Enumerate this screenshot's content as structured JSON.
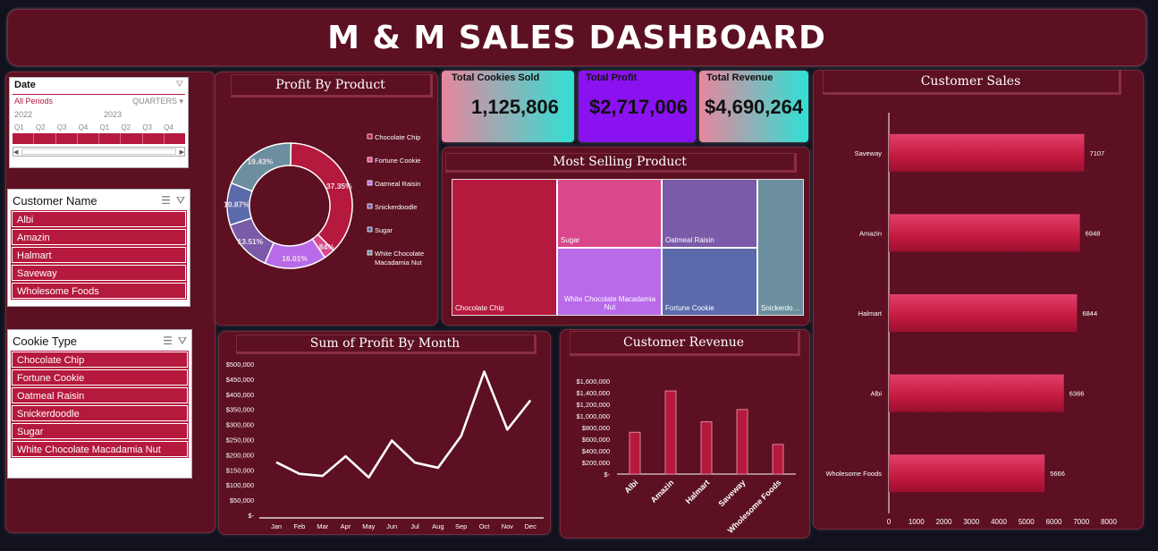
{
  "header": {
    "title": "M & M SALES DASHBOARD"
  },
  "date_slicer": {
    "label": "Date",
    "all_periods": "All Periods",
    "granularity": "QUARTERS",
    "years": [
      "2022",
      "2023"
    ],
    "quarters": [
      "Q1",
      "Q2",
      "Q3",
      "Q4",
      "Q1",
      "Q2",
      "Q3",
      "Q4"
    ]
  },
  "customer_slicer": {
    "label": "Customer Name",
    "items": [
      "Albi",
      "Amazin",
      "Halmart",
      "Saveway",
      "Wholesome Foods"
    ]
  },
  "cookie_slicer": {
    "label": "Cookie Type",
    "items": [
      "Chocolate Chip",
      "Fortune Cookie",
      "Oatmeal Raisin",
      "Snickerdoodle",
      "Sugar",
      "White Chocolate Macadamia Nut"
    ]
  },
  "kpis": {
    "cookies_label": "Total Cookies Sold",
    "cookies_value": "1,125,806",
    "profit_label": "Total Profit",
    "profit_value": "$2,717,006",
    "revenue_label": "Total Revenue",
    "revenue_value": "$4,690,264"
  },
  "titles": {
    "profit_by_product": "Profit By Product",
    "most_selling": "Most Selling Product",
    "customer_sales": "Customer Sales",
    "profit_by_month": "Sum of Profit By Month",
    "customer_revenue": "Customer Revenue"
  },
  "colors": {
    "panel": "#5c1022",
    "crimson": "#b5193e",
    "pink": "#d9488a",
    "violet": "#b86ae8",
    "purple": "#7b5aa8",
    "slate_blue": "#5a6aaa",
    "teal_gray": "#6b8f9e"
  },
  "chart_data": [
    {
      "id": "profit_by_product",
      "type": "pie",
      "title": "Profit By Product",
      "categories": [
        "Chocolate Chip",
        "Fortune Cookie",
        "Oatmeal Raisin",
        "Snickerdoodle",
        "Sugar",
        "White Chocolate Macadamia Nut"
      ],
      "values": [
        37.35,
        2.84,
        16.01,
        13.51,
        10.87,
        19.43
      ],
      "labels": [
        "37.35%",
        "2.84%",
        "16.01%",
        "13.51%",
        "10.87%",
        "19.43%"
      ],
      "legend": "right"
    },
    {
      "id": "most_selling_product",
      "type": "heatmap",
      "title": "Most Selling Product",
      "categories": [
        "Chocolate Chip",
        "Sugar",
        "White Chocolate Macadamia Nut",
        "Oatmeal Raisin",
        "Fortune Cookie",
        "Snickerdo…"
      ]
    },
    {
      "id": "customer_sales",
      "type": "bar",
      "title": "Customer Sales",
      "orientation": "horizontal",
      "categories": [
        "Saveway",
        "Amazin",
        "Halmart",
        "Albi",
        "Wholesome Foods"
      ],
      "values": [
        7107,
        6948,
        6844,
        6366,
        5666
      ],
      "xlim": [
        0,
        8000
      ],
      "ticks": [
        "0",
        "1000",
        "2000",
        "3000",
        "4000",
        "5000",
        "6000",
        "7000",
        "8000"
      ]
    },
    {
      "id": "profit_by_month",
      "type": "line",
      "title": "Sum of Profit By Month",
      "categories": [
        "Jan",
        "Feb",
        "Mar",
        "Apr",
        "May",
        "Jun",
        "Jul",
        "Aug",
        "Sep",
        "Oct",
        "Nov",
        "Dec"
      ],
      "values": [
        175000,
        137000,
        130000,
        195000,
        125000,
        247000,
        174000,
        157000,
        262000,
        475000,
        283000,
        380000
      ],
      "ylim": [
        0,
        500000
      ],
      "yticks": [
        "$-",
        "$50,000",
        "$100,000",
        "$150,000",
        "$200,000",
        "$250,000",
        "$300,000",
        "$350,000",
        "$400,000",
        "$450,000",
        "$500,000"
      ]
    },
    {
      "id": "customer_revenue",
      "type": "bar",
      "title": "Customer Revenue",
      "categories": [
        "Albi",
        "Amazin",
        "Halmart",
        "Saveway",
        "Wholesome Foods"
      ],
      "values": [
        720000,
        1430000,
        900000,
        1110000,
        510000
      ],
      "ylim": [
        0,
        1600000
      ],
      "yticks": [
        "$-",
        "$200,000",
        "$400,000",
        "$600,000",
        "$800,000",
        "$1,000,000",
        "$1,200,000",
        "$1,400,000",
        "$1,600,000"
      ]
    }
  ]
}
